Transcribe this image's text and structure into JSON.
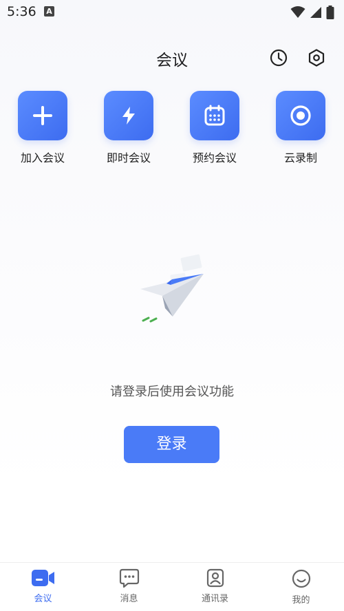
{
  "status_bar": {
    "time": "5:36",
    "notif_badge": "A"
  },
  "header": {
    "title": "会议"
  },
  "icons": {
    "history": "clock-icon",
    "settings": "hexagon-settings-icon"
  },
  "actions": [
    {
      "label": "加入会议",
      "icon": "plus-icon"
    },
    {
      "label": "即时会议",
      "icon": "lightning-icon"
    },
    {
      "label": "预约会议",
      "icon": "calendar-icon"
    },
    {
      "label": "云录制",
      "icon": "record-icon"
    }
  ],
  "empty_state": {
    "message": "请登录后使用会议功能",
    "login_label": "登录"
  },
  "bottom_nav": [
    {
      "label": "会议",
      "active": true
    },
    {
      "label": "消息",
      "active": false
    },
    {
      "label": "通讯录",
      "active": false
    },
    {
      "label": "我的",
      "active": false
    }
  ],
  "colors": {
    "accent": "#4a7bf7",
    "tile": "#4d7cf5",
    "text": "#222222"
  }
}
